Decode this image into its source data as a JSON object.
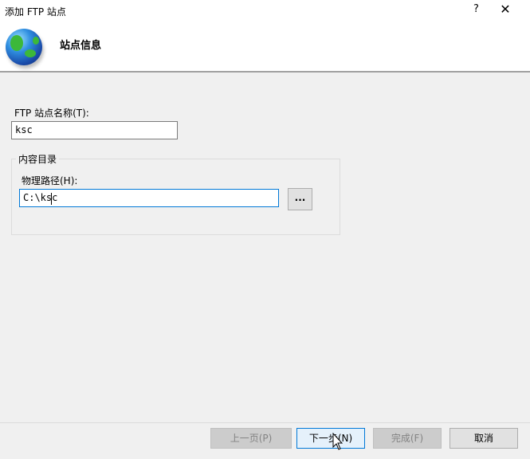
{
  "window": {
    "title": "添加 FTP 站点",
    "help_label": "?",
    "close_label": "✕"
  },
  "header": {
    "title": "站点信息",
    "icon": "globe-icon"
  },
  "form": {
    "site_name_label": "FTP 站点名称(T):",
    "site_name_value": "ksc",
    "content_group_label": "内容目录",
    "path_label": "物理路径(H):",
    "path_value": "C:\\ksc",
    "browse_label": "..."
  },
  "footer": {
    "prev_label": "上一页(P)",
    "next_label": "下一步(N)",
    "finish_label": "完成(F)",
    "cancel_label": "取消"
  }
}
